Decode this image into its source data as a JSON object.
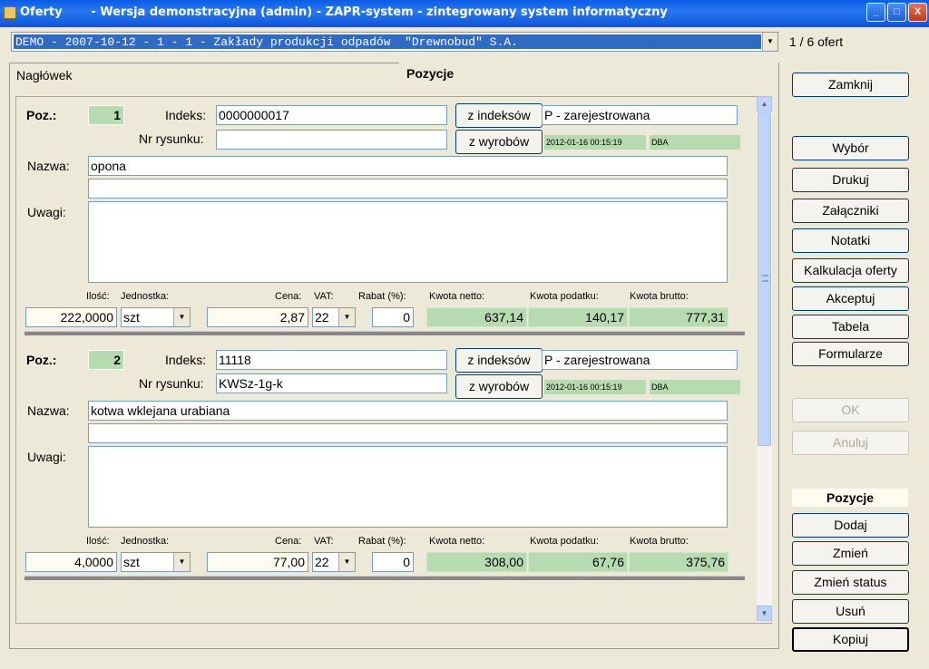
{
  "window": {
    "title": "Oferty       - Wersja demonstracyjna (admin) - ZAPR-system - zintegrowany system informatyczny",
    "minimize": "_",
    "maximize": "□",
    "close": "X"
  },
  "offer_selector": {
    "value": "DEMO - 2007-10-12 - 1 - 1 - Zakłady produkcji odpadów  \"Drewnobud\" S.A.",
    "count": "1 / 6 ofert"
  },
  "tabs": [
    {
      "label": "Nagłówek"
    },
    {
      "label": "Pozycje"
    }
  ],
  "labels": {
    "poz": "Poz.:",
    "indeks": "Indeks:",
    "nr_rysunku": "Nr rysunku:",
    "nazwa": "Nazwa:",
    "uwagi": "Uwagi:",
    "ilosc": "Ilość:",
    "jednostka": "Jednostka:",
    "cena": "Cena:",
    "vat": "VAT:",
    "rabat": "Rabat (%):",
    "kwota_netto": "Kwota netto:",
    "kwota_podatku": "Kwota podatku:",
    "kwota_brutto": "Kwota brutto:",
    "z_indeksow": "z indeksów",
    "z_wyrobow": "z wyrobów"
  },
  "positions": [
    {
      "number": "1",
      "indeks": "0000000017",
      "nr_rysunku": "",
      "status": "P - zarejestrowana",
      "timestamp": "2012-01-16 00:15:19",
      "user": "DBA",
      "nazwa": "opona",
      "nazwa2": "",
      "uwagi": "",
      "ilosc": "222,0000",
      "jednostka": "szt",
      "cena": "2,87",
      "vat": "22",
      "rabat": "0",
      "kwota_netto": "637,14",
      "kwota_podatku": "140,17",
      "kwota_brutto": "777,31"
    },
    {
      "number": "2",
      "indeks": "11118",
      "nr_rysunku": "KWSz-1g-k",
      "status": "P - zarejestrowana",
      "timestamp": "2012-01-16 00:15:19",
      "user": "DBA",
      "nazwa": "kotwa wklejana urabiana",
      "nazwa2": "",
      "uwagi": "",
      "ilosc": "4,0000",
      "jednostka": "szt",
      "cena": "77,00",
      "vat": "22",
      "rabat": "0",
      "kwota_netto": "308,00",
      "kwota_podatku": "67,76",
      "kwota_brutto": "375,76"
    }
  ],
  "sidebar": {
    "zamknij": "Zamknij",
    "wybor": "Wybór",
    "drukuj": "Drukuj",
    "zalaczniki": "Załączniki",
    "notatki": "Notatki",
    "kalkulacja": "Kalkulacja oferty",
    "akceptuj": "Akceptuj",
    "tabela": "Tabela",
    "formularze": "Formularze",
    "ok": "OK",
    "anuluj": "Anuluj",
    "section_title": "Pozycje",
    "dodaj": "Dodaj",
    "zmien": "Zmień",
    "zmien_status": "Zmień status",
    "usun": "Usuń",
    "kopiuj": "Kopiuj"
  }
}
